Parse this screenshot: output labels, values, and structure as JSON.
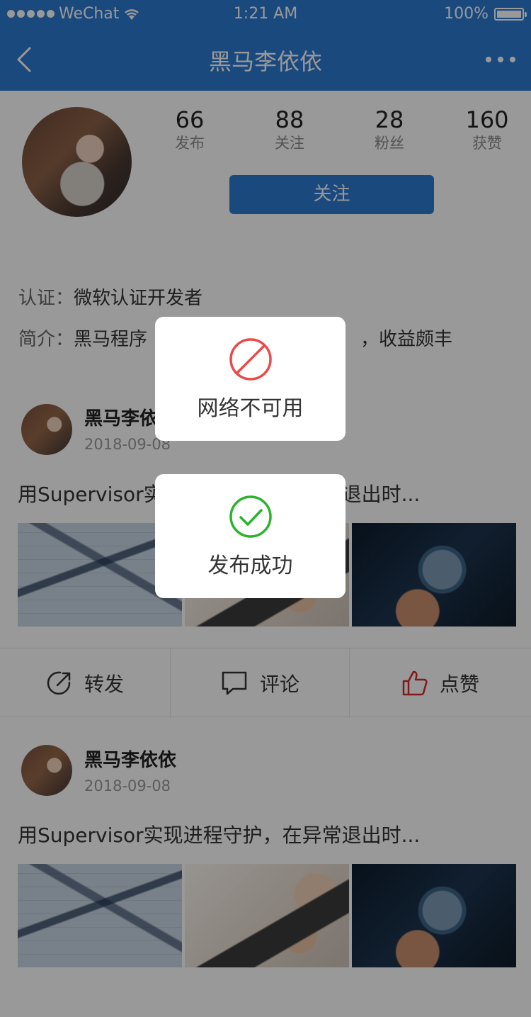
{
  "status_bar": {
    "carrier": "WeChat",
    "time": "1:21 AM",
    "battery": "100%"
  },
  "nav": {
    "title": "黑马李依依"
  },
  "profile": {
    "stats": [
      {
        "value": "66",
        "label": "发布"
      },
      {
        "value": "88",
        "label": "关注"
      },
      {
        "value": "28",
        "label": "粉丝"
      },
      {
        "value": "160",
        "label": "获赞"
      }
    ],
    "follow_label": "关注",
    "cert_key": "认证：",
    "cert_value": "微软认证开发者",
    "intro_key": "简介：",
    "intro_value_start": "黑马程序",
    "intro_value_end": "，收益颇丰"
  },
  "posts": [
    {
      "author": "黑马李依依",
      "date": "2018-09-08",
      "text": "用Supervisor实现进程守护，在异常退出时..."
    },
    {
      "author": "黑马李依依",
      "date": "2018-09-08",
      "text": "用Supervisor实现进程守护，在异常退出时..."
    }
  ],
  "actions": {
    "share": "转发",
    "comment": "评论",
    "like": "点赞"
  },
  "toasts": {
    "network_error": "网络不可用",
    "publish_success": "发布成功"
  },
  "colors": {
    "brand": "#2c7ad2",
    "error": "#ea4a4a",
    "success": "#2db22d",
    "like": "#d52b2b"
  }
}
